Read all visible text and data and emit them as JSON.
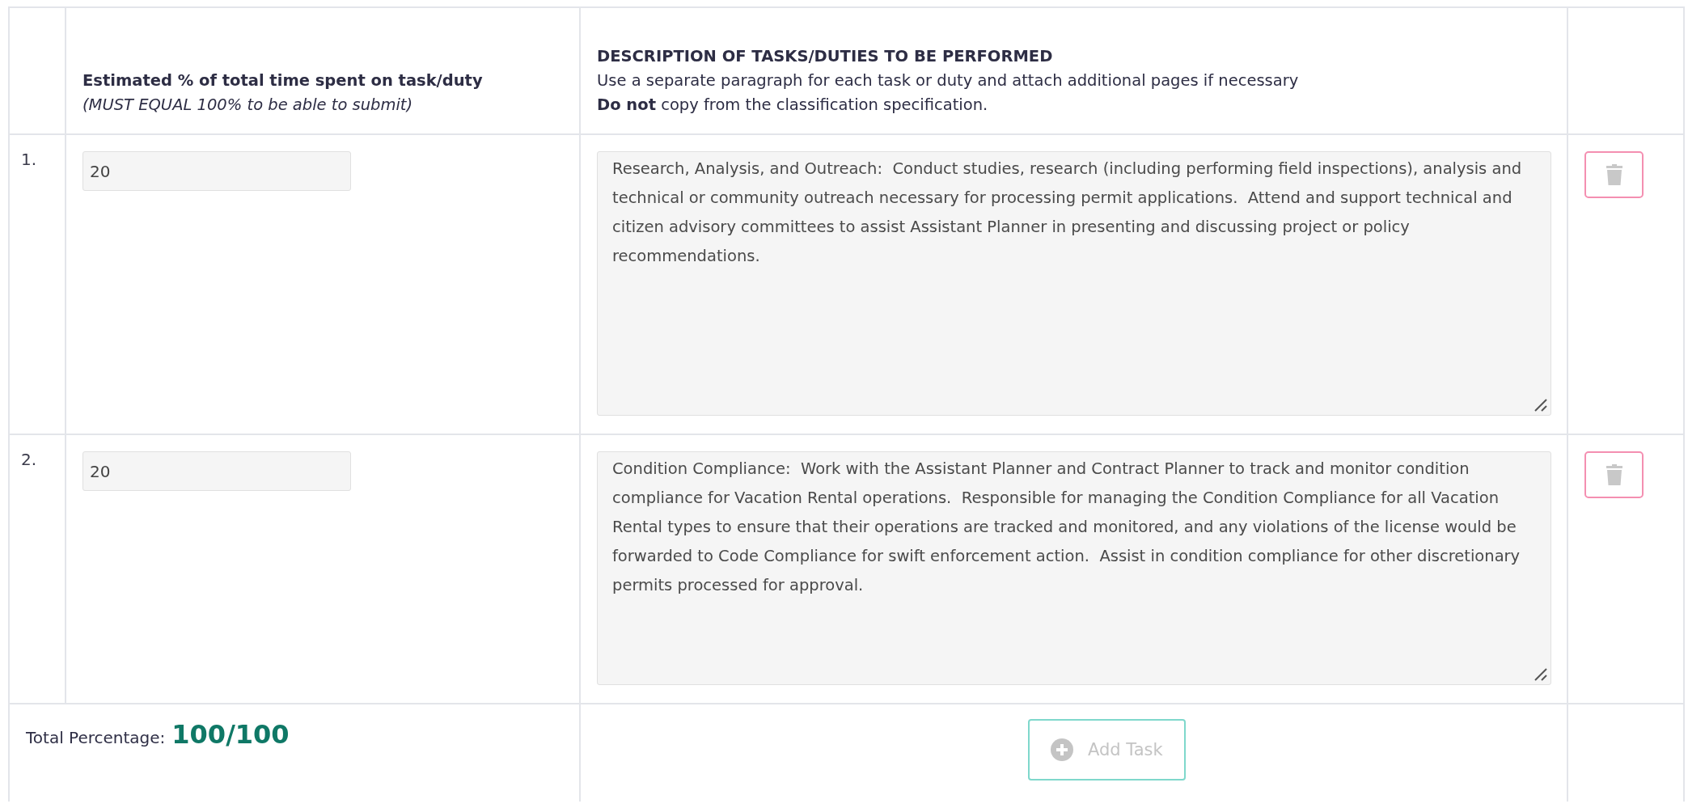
{
  "header": {
    "percent_title": "Estimated % of total time spent on task/duty",
    "percent_note": "(MUST EQUAL 100% to be able to submit)",
    "description_title": "DESCRIPTION OF TASKS/DUTIES TO BE PERFORMED",
    "description_note": "Use a separate paragraph for each task or duty and attach additional pages if necessary",
    "description_warning": "**Do not** copy from the classification specification."
  },
  "tasks": [
    {
      "number": "1.",
      "percent": "20",
      "description": "Research, Analysis, and Outreach:  Conduct studies, research (including performing field inspections), analysis and technical or community outreach necessary for processing permit applications.  Attend and support technical and citizen advisory committees to assist Assistant Planner in presenting and discussing project or policy recommendations."
    },
    {
      "number": "2.",
      "percent": "20",
      "description": "Condition Compliance:  Work with the Assistant Planner and Contract Planner to track and monitor condition compliance for Vacation Rental operations.  Responsible for managing the Condition Compliance for all Vacation Rental types to ensure that their operations are tracked and monitored, and any violations of the license would be forwarded to Code Compliance for swift enforcement action.  Assist in condition compliance for other discretionary permits processed for approval."
    }
  ],
  "footer": {
    "total_label": "Total Percentage:",
    "total_value": "100/100",
    "add_button": {
      "label": "Add Task",
      "disabled": true
    }
  }
}
